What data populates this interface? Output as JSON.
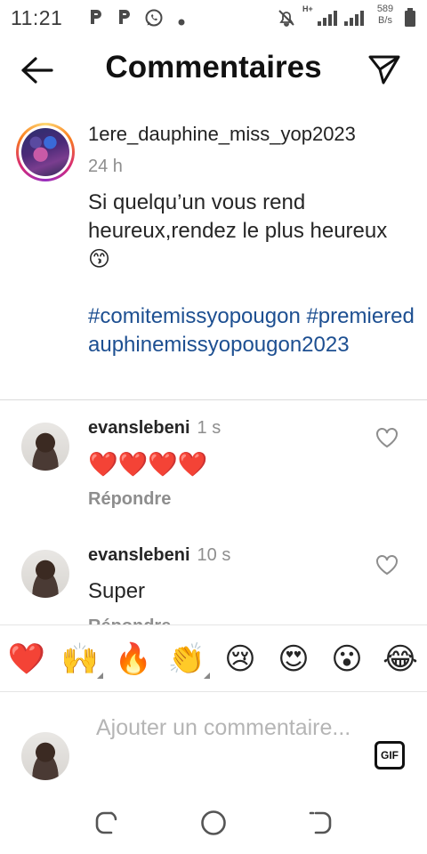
{
  "status_bar": {
    "time": "11:21",
    "notification_icons": [
      "p-app-icon",
      "p-app-icon",
      "whatsapp-icon",
      "dot-icon"
    ],
    "net_speed_value": "589",
    "net_speed_unit": "B/s",
    "network_label": "H+"
  },
  "header": {
    "title": "Commentaires",
    "back_icon": "arrow-left-icon",
    "send_icon": "paper-plane-icon"
  },
  "caption": {
    "username": "1ere_dauphine_miss_yop2023",
    "time": "24 h",
    "text": "Si quelqu’un vous rend heureux,rendez le plus heureux😙",
    "hashtags": "#comitemissyopougon #premieredauphinemissyopougon2023"
  },
  "comments": [
    {
      "username": "evanslebeni",
      "time": "1 s",
      "text": "❤️❤️❤️❤️",
      "reply_label": "Répondre"
    },
    {
      "username": "evanslebeni",
      "time": "10 s",
      "text": "Super",
      "reply_label": "Répondre"
    }
  ],
  "emoji_bar": [
    "❤️",
    "🙌",
    "🔥",
    "👏",
    "😢",
    "😍",
    "😮",
    "😂"
  ],
  "composer": {
    "placeholder": "Ajouter un commentaire...",
    "gif_label": "GIF"
  },
  "colors": {
    "accent_link": "#1d4f91",
    "secondary_text": "#8e8e8e",
    "heart_red": "#e0282e"
  }
}
